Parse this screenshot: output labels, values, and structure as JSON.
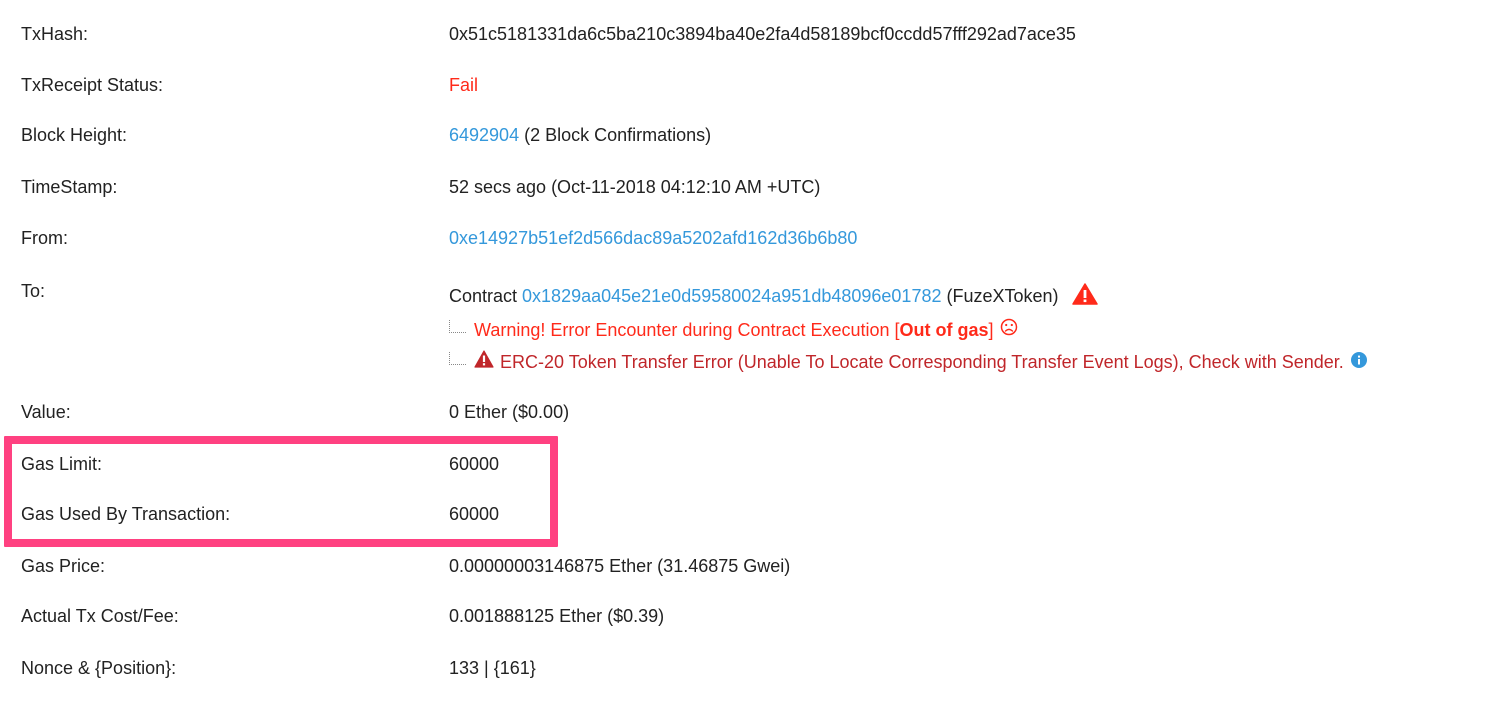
{
  "rows": {
    "txhash": {
      "label": "TxHash:",
      "value": "0x51c5181331da6c5ba210c3894ba40e2fa4d58189bcf0ccdd57fff292ad7ace35"
    },
    "status": {
      "label": "TxReceipt Status:",
      "value": "Fail"
    },
    "block": {
      "label": "Block Height:",
      "link": "6492904",
      "suffix": " (2 Block Confirmations)"
    },
    "timestamp": {
      "label": "TimeStamp:",
      "value": "52 secs ago (Oct-11-2018 04:12:10 AM +UTC)"
    },
    "from": {
      "label": "From:",
      "link": "0xe14927b51ef2d566dac89a5202afd162d36b6b80"
    },
    "to": {
      "label": "To:",
      "prefix": "Contract ",
      "link": "0x1829aa045e21e0d59580024a951db48096e01782",
      "suffix": " (FuzeXToken)",
      "warning_prefix": "Warning! Error Encounter during Contract Execution [",
      "warning_bold": "Out of gas",
      "warning_suffix": "]",
      "erc20_error": "ERC-20 Token Transfer Error (Unable To Locate Corresponding Transfer Event Logs), Check with Sender."
    },
    "value": {
      "label": "Value:",
      "value": "0 Ether ($0.00)"
    },
    "gas_limit": {
      "label": "Gas Limit:",
      "value": "60000"
    },
    "gas_used": {
      "label": "Gas Used By Transaction:",
      "value": "60000"
    },
    "gas_price": {
      "label": "Gas Price:",
      "value": "0.00000003146875 Ether (31.46875 Gwei)"
    },
    "fee": {
      "label": "Actual Tx Cost/Fee:",
      "value": "0.001888125 Ether ($0.39)"
    },
    "nonce": {
      "label": "Nonce & {Position}:",
      "value": "133 | {161}"
    }
  },
  "icons": {
    "warning_triangle": "warning-triangle-icon",
    "sad_face": "sad-face-icon",
    "info": "info-circle-icon"
  },
  "colors": {
    "link": "#3498db",
    "fail": "#ff2a1a",
    "error_dark": "#c0262a",
    "highlight": "#ff4181",
    "info": "#3498db"
  }
}
